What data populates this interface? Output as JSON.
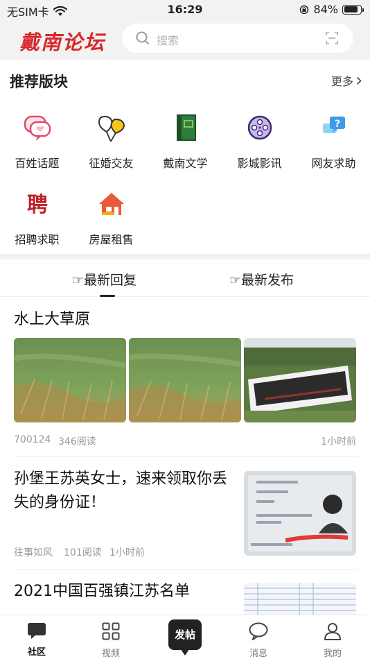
{
  "status_bar": {
    "carrier": "无SIM卡",
    "time": "16:29",
    "battery": "84%",
    "battery_level": 0.84
  },
  "header": {
    "logo": "戴南论坛",
    "search_placeholder": "搜索"
  },
  "recommended": {
    "title": "推荐版块",
    "more": "更多",
    "items": [
      {
        "label": "百姓话题",
        "icon": "chat-bubbles-icon"
      },
      {
        "label": "征婚交友",
        "icon": "balloons-icon"
      },
      {
        "label": "戴南文学",
        "icon": "book-icon"
      },
      {
        "label": "影城影讯",
        "icon": "film-reel-icon"
      },
      {
        "label": "网友求助",
        "icon": "help-question-icon"
      },
      {
        "label": "招聘求职",
        "icon": "hire-icon"
      },
      {
        "label": "房屋租售",
        "icon": "house-icon"
      }
    ]
  },
  "tabs": {
    "latest_reply": "☞最新回复",
    "latest_post": "☞最新发布",
    "active": "latest_reply"
  },
  "feed": [
    {
      "title": "水上大草原",
      "author": "700124",
      "views": "346阅读",
      "time": "1小时前"
    },
    {
      "title": "孙堡王苏英女士，速来领取你丢失的身份证！",
      "author": "往事如风",
      "views": "101阅读",
      "time": "1小时前"
    },
    {
      "title": "2021中国百强镇江苏名单"
    }
  ],
  "bottom_nav": {
    "community": "社区",
    "video": "视频",
    "post": "发帖",
    "messages": "消息",
    "mine": "我的"
  },
  "colors": {
    "brand": "#d8282d",
    "text": "#222222",
    "muted": "#999999"
  }
}
